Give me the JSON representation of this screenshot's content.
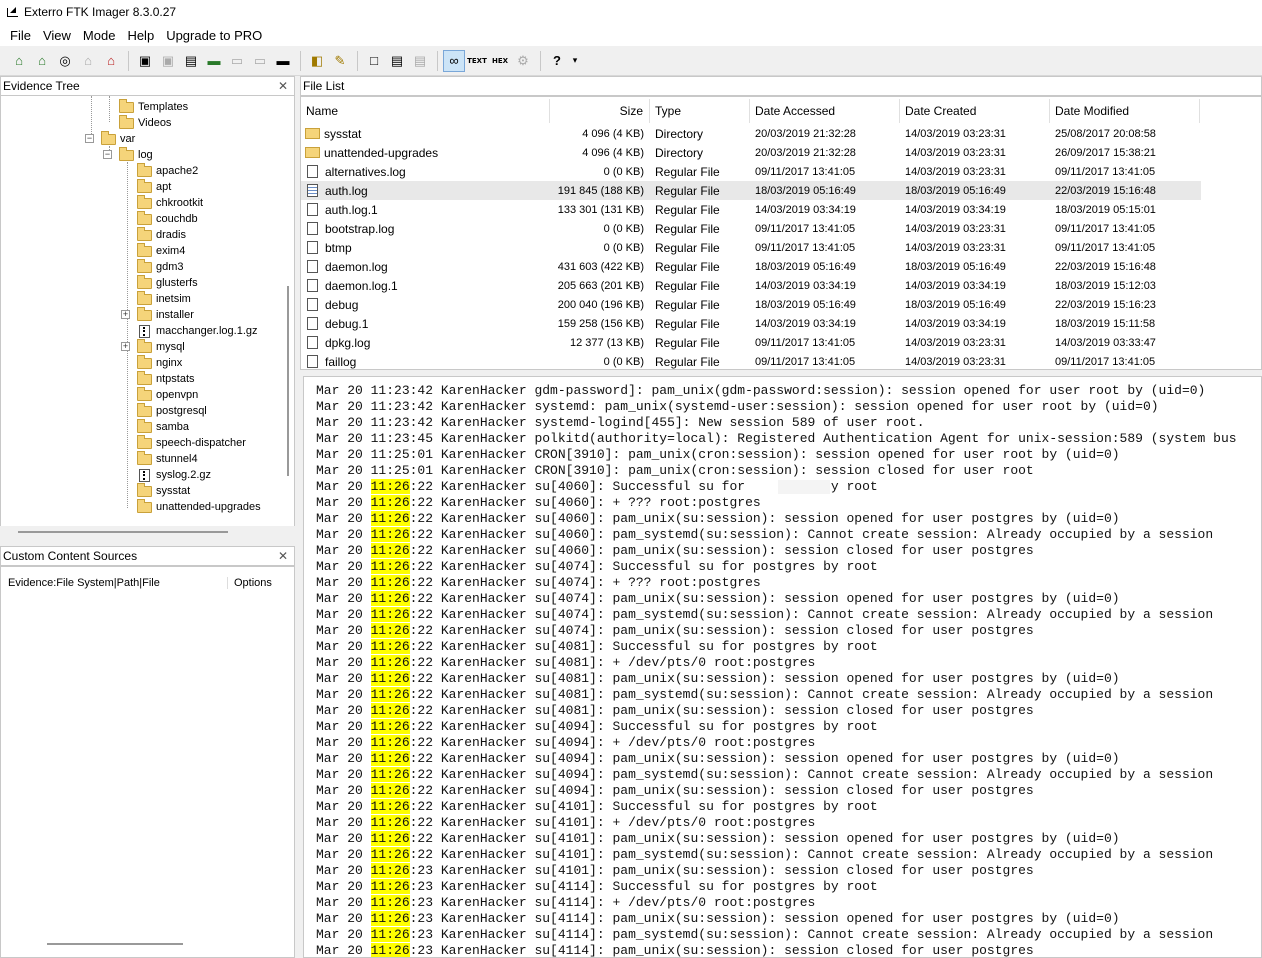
{
  "window": {
    "title": "Exterro FTK Imager 8.3.0.27"
  },
  "menu": [
    {
      "label": "File"
    },
    {
      "label": "View"
    },
    {
      "label": "Mode"
    },
    {
      "label": "Help"
    },
    {
      "label": "Upgrade to PRO"
    }
  ],
  "toolbar": {
    "text_view_label": "TEXT",
    "hex_view_label": "HEX"
  },
  "evidence_tree": {
    "title": "Evidence Tree",
    "nodes": [
      {
        "label": "Templates"
      },
      {
        "label": "Videos"
      },
      {
        "label": "var"
      },
      {
        "label": "log"
      },
      {
        "label": "apache2"
      },
      {
        "label": "apt"
      },
      {
        "label": "chkrootkit"
      },
      {
        "label": "couchdb"
      },
      {
        "label": "dradis"
      },
      {
        "label": "exim4"
      },
      {
        "label": "gdm3"
      },
      {
        "label": "glusterfs"
      },
      {
        "label": "inetsim"
      },
      {
        "label": "installer"
      },
      {
        "label": "macchanger.log.1.gz"
      },
      {
        "label": "mysql"
      },
      {
        "label": "nginx"
      },
      {
        "label": "ntpstats"
      },
      {
        "label": "openvpn"
      },
      {
        "label": "postgresql"
      },
      {
        "label": "samba"
      },
      {
        "label": "speech-dispatcher"
      },
      {
        "label": "stunnel4"
      },
      {
        "label": "syslog.2.gz"
      },
      {
        "label": "sysstat"
      },
      {
        "label": "unattended-upgrades"
      }
    ]
  },
  "custom_content_sources": {
    "title": "Custom Content Sources",
    "col_evidence": "Evidence:File System|Path|File",
    "col_options": "Options"
  },
  "file_list": {
    "title": "File List",
    "columns": {
      "name": "Name",
      "size": "Size",
      "type": "Type",
      "accessed": "Date Accessed",
      "created": "Date Created",
      "modified": "Date Modified"
    },
    "rows": [
      {
        "name": "sysstat",
        "size": "4 096 (4 KB)",
        "type": "Directory",
        "accessed": "20/03/2019 21:32:28",
        "created": "14/03/2019 03:23:31",
        "modified": "25/08/2017 20:08:58"
      },
      {
        "name": "unattended-upgrades",
        "size": "4 096 (4 KB)",
        "type": "Directory",
        "accessed": "20/03/2019 21:32:28",
        "created": "14/03/2019 03:23:31",
        "modified": "26/09/2017 15:38:21"
      },
      {
        "name": "alternatives.log",
        "size": "0 (0 KB)",
        "type": "Regular File",
        "accessed": "09/11/2017 13:41:05",
        "created": "14/03/2019 03:23:31",
        "modified": "09/11/2017 13:41:05"
      },
      {
        "name": "auth.log",
        "size": "191 845 (188 KB)",
        "type": "Regular File",
        "accessed": "18/03/2019 05:16:49",
        "created": "18/03/2019 05:16:49",
        "modified": "22/03/2019 15:16:48"
      },
      {
        "name": "auth.log.1",
        "size": "133 301 (131 KB)",
        "type": "Regular File",
        "accessed": "14/03/2019 03:34:19",
        "created": "14/03/2019 03:34:19",
        "modified": "18/03/2019 05:15:01"
      },
      {
        "name": "bootstrap.log",
        "size": "0 (0 KB)",
        "type": "Regular File",
        "accessed": "09/11/2017 13:41:05",
        "created": "14/03/2019 03:23:31",
        "modified": "09/11/2017 13:41:05"
      },
      {
        "name": "btmp",
        "size": "0 (0 KB)",
        "type": "Regular File",
        "accessed": "09/11/2017 13:41:05",
        "created": "14/03/2019 03:23:31",
        "modified": "09/11/2017 13:41:05"
      },
      {
        "name": "daemon.log",
        "size": "431 603 (422 KB)",
        "type": "Regular File",
        "accessed": "18/03/2019 05:16:49",
        "created": "18/03/2019 05:16:49",
        "modified": "22/03/2019 15:16:48"
      },
      {
        "name": "daemon.log.1",
        "size": "205 663 (201 KB)",
        "type": "Regular File",
        "accessed": "14/03/2019 03:34:19",
        "created": "14/03/2019 03:34:19",
        "modified": "18/03/2019 15:12:03"
      },
      {
        "name": "debug",
        "size": "200 040 (196 KB)",
        "type": "Regular File",
        "accessed": "18/03/2019 05:16:49",
        "created": "18/03/2019 05:16:49",
        "modified": "22/03/2019 15:16:23"
      },
      {
        "name": "debug.1",
        "size": "159 258 (156 KB)",
        "type": "Regular File",
        "accessed": "14/03/2019 03:34:19",
        "created": "14/03/2019 03:34:19",
        "modified": "18/03/2019 15:11:58"
      },
      {
        "name": "dpkg.log",
        "size": "12 377 (13 KB)",
        "type": "Regular File",
        "accessed": "09/11/2017 13:41:05",
        "created": "14/03/2019 03:23:31",
        "modified": "14/03/2019 03:33:47"
      },
      {
        "name": "faillog",
        "size": "0 (0 KB)",
        "type": "Regular File",
        "accessed": "09/11/2017 13:41:05",
        "created": "14/03/2019 03:23:31",
        "modified": "09/11/2017 13:41:05"
      }
    ]
  },
  "log_view": {
    "lines": [
      {
        "pre": "Mar 20 ",
        "hl": "",
        "time": "11:23:42",
        "rest": " KarenHacker gdm-password]: pam_unix(gdm-password:session): session opened for user root by (uid=0)"
      },
      {
        "pre": "Mar 20 ",
        "hl": "",
        "time": "11:23:42",
        "rest": " KarenHacker systemd: pam_unix(systemd-user:session): session opened for user root by (uid=0)"
      },
      {
        "pre": "Mar 20 ",
        "hl": "",
        "time": "11:23:42",
        "rest": " KarenHacker systemd-logind[455]: New session 589 of user root."
      },
      {
        "pre": "Mar 20 ",
        "hl": "",
        "time": "11:23:45",
        "rest": " KarenHacker polkitd(authority=local): Registered Authentication Agent for unix-session:589 (system bus"
      },
      {
        "pre": "Mar 20 ",
        "hl": "",
        "time": "11:25:01",
        "rest": " KarenHacker CRON[3910]: pam_unix(cron:session): session opened for user root by (uid=0)"
      },
      {
        "pre": "Mar 20 ",
        "hl": "",
        "time": "11:25:01",
        "rest": " KarenHacker CRON[3910]: pam_unix(cron:session): session closed for user root"
      },
      {
        "pre": "Mar 20 ",
        "hl": "11:26",
        "time": ":22",
        "rest": " KarenHacker su[4060]: Successful su for          by root"
      },
      {
        "pre": "Mar 20 ",
        "hl": "11:26",
        "time": ":22",
        "rest": " KarenHacker su[4060]: + ??? root:postgres"
      },
      {
        "pre": "Mar 20 ",
        "hl": "11:26",
        "time": ":22",
        "rest": " KarenHacker su[4060]: pam_unix(su:session): session opened for user postgres by (uid=0)"
      },
      {
        "pre": "Mar 20 ",
        "hl": "11:26",
        "time": ":22",
        "rest": " KarenHacker su[4060]: pam_systemd(su:session): Cannot create session: Already occupied by a session"
      },
      {
        "pre": "Mar 20 ",
        "hl": "11:26",
        "time": ":22",
        "rest": " KarenHacker su[4060]: pam_unix(su:session): session closed for user postgres"
      },
      {
        "pre": "Mar 20 ",
        "hl": "11:26",
        "time": ":22",
        "rest": " KarenHacker su[4074]: Successful su for postgres by root"
      },
      {
        "pre": "Mar 20 ",
        "hl": "11:26",
        "time": ":22",
        "rest": " KarenHacker su[4074]: + ??? root:postgres"
      },
      {
        "pre": "Mar 20 ",
        "hl": "11:26",
        "time": ":22",
        "rest": " KarenHacker su[4074]: pam_unix(su:session): session opened for user postgres by (uid=0)"
      },
      {
        "pre": "Mar 20 ",
        "hl": "11:26",
        "time": ":22",
        "rest": " KarenHacker su[4074]: pam_systemd(su:session): Cannot create session: Already occupied by a session"
      },
      {
        "pre": "Mar 20 ",
        "hl": "11:26",
        "time": ":22",
        "rest": " KarenHacker su[4074]: pam_unix(su:session): session closed for user postgres"
      },
      {
        "pre": "Mar 20 ",
        "hl": "11:26",
        "time": ":22",
        "rest": " KarenHacker su[4081]: Successful su for postgres by root"
      },
      {
        "pre": "Mar 20 ",
        "hl": "11:26",
        "time": ":22",
        "rest": " KarenHacker su[4081]: + /dev/pts/0 root:postgres"
      },
      {
        "pre": "Mar 20 ",
        "hl": "11:26",
        "time": ":22",
        "rest": " KarenHacker su[4081]: pam_unix(su:session): session opened for user postgres by (uid=0)"
      },
      {
        "pre": "Mar 20 ",
        "hl": "11:26",
        "time": ":22",
        "rest": " KarenHacker su[4081]: pam_systemd(su:session): Cannot create session: Already occupied by a session"
      },
      {
        "pre": "Mar 20 ",
        "hl": "11:26",
        "time": ":22",
        "rest": " KarenHacker su[4081]: pam_unix(su:session): session closed for user postgres"
      },
      {
        "pre": "Mar 20 ",
        "hl": "11:26",
        "time": ":22",
        "rest": " KarenHacker su[4094]: Successful su for postgres by root"
      },
      {
        "pre": "Mar 20 ",
        "hl": "11:26",
        "time": ":22",
        "rest": " KarenHacker su[4094]: + /dev/pts/0 root:postgres"
      },
      {
        "pre": "Mar 20 ",
        "hl": "11:26",
        "time": ":22",
        "rest": " KarenHacker su[4094]: pam_unix(su:session): session opened for user postgres by (uid=0)"
      },
      {
        "pre": "Mar 20 ",
        "hl": "11:26",
        "time": ":22",
        "rest": " KarenHacker su[4094]: pam_systemd(su:session): Cannot create session: Already occupied by a session"
      },
      {
        "pre": "Mar 20 ",
        "hl": "11:26",
        "time": ":22",
        "rest": " KarenHacker su[4094]: pam_unix(su:session): session closed for user postgres"
      },
      {
        "pre": "Mar 20 ",
        "hl": "11:26",
        "time": ":22",
        "rest": " KarenHacker su[4101]: Successful su for postgres by root"
      },
      {
        "pre": "Mar 20 ",
        "hl": "11:26",
        "time": ":22",
        "rest": " KarenHacker su[4101]: + /dev/pts/0 root:postgres"
      },
      {
        "pre": "Mar 20 ",
        "hl": "11:26",
        "time": ":22",
        "rest": " KarenHacker su[4101]: pam_unix(su:session): session opened for user postgres by (uid=0)"
      },
      {
        "pre": "Mar 20 ",
        "hl": "11:26",
        "time": ":22",
        "rest": " KarenHacker su[4101]: pam_systemd(su:session): Cannot create session: Already occupied by a session"
      },
      {
        "pre": "Mar 20 ",
        "hl": "11:26",
        "time": ":23",
        "rest": " KarenHacker su[4101]: pam_unix(su:session): session closed for user postgres"
      },
      {
        "pre": "Mar 20 ",
        "hl": "11:26",
        "time": ":23",
        "rest": " KarenHacker su[4114]: Successful su for postgres by root"
      },
      {
        "pre": "Mar 20 ",
        "hl": "11:26",
        "time": ":23",
        "rest": " KarenHacker su[4114]: + /dev/pts/0 root:postgres"
      },
      {
        "pre": "Mar 20 ",
        "hl": "11:26",
        "time": ":23",
        "rest": " KarenHacker su[4114]: pam_unix(su:session): session opened for user postgres by (uid=0)"
      },
      {
        "pre": "Mar 20 ",
        "hl": "11:26",
        "time": ":23",
        "rest": " KarenHacker su[4114]: pam_systemd(su:session): Cannot create session: Already occupied by a session"
      },
      {
        "pre": "Mar 20 ",
        "hl": "11:26",
        "time": ":23",
        "rest": " KarenHacker su[4114]: pam_unix(su:session): session closed for user postgres"
      }
    ],
    "highlight_color": "#ffff00"
  }
}
